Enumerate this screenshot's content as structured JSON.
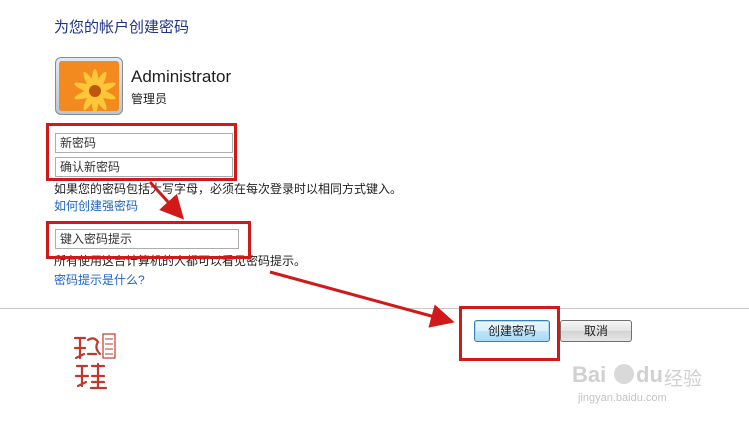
{
  "page": {
    "title": "为您的帐户创建密码"
  },
  "account": {
    "name": "Administrator",
    "role": "管理员"
  },
  "form": {
    "new_password_placeholder": "新密码",
    "confirm_password_placeholder": "确认新密码",
    "caps_note": "如果您的密码包括大写字母，必须在每次登录时以相同方式键入。",
    "strong_password_link": "如何创建强密码",
    "hint_placeholder": "键入密码提示",
    "hint_note": "所有使用这台计算机的人都可以看见密码提示。",
    "hint_link": "密码提示是什么?"
  },
  "buttons": {
    "create_label": "创建密码",
    "cancel_label": "取消"
  },
  "annotations": {
    "color": "#d01a1a"
  },
  "icons": [
    "flower-avatar-icon",
    "seal-stamp-icon",
    "paw-icon"
  ],
  "watermark": {
    "brand_text": "Bai",
    "brand_suffix": "du",
    "cn_text": "经验",
    "url": "jingyan.baidu.com"
  }
}
